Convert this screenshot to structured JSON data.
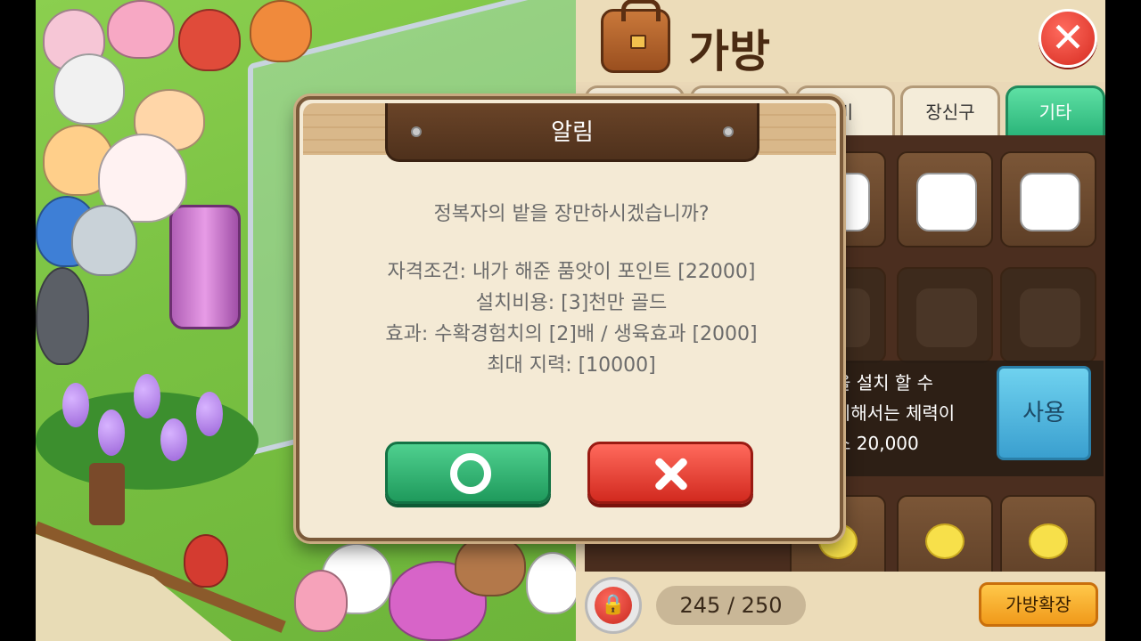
{
  "bag": {
    "title": "가방",
    "tabs": [
      "",
      "",
      "비",
      "장신구",
      "기타"
    ],
    "active_tab": "기타",
    "info_lines": [
      "을 설치 할 수",
      "위해서는 체력이",
      "소 20,000"
    ],
    "use_label": "사용",
    "count": "245 / 250",
    "expand_label": "가방확장",
    "accent_active_tab": "#2bb57a",
    "accent_close": "#d62b20"
  },
  "dialog": {
    "title": "알림",
    "question": "정복자의 밭을 장만하시겠습니까?",
    "lines": [
      "자격조건: 내가 해준 품앗이 포인트 [22000]",
      "설치비용: [3]천만 골드",
      "효과: 수확경험치의 [2]배 / 생육효과 [2000]",
      "최대 지력: [10000]"
    ],
    "confirm_icon": "circle-o-icon",
    "cancel_icon": "x-icon"
  }
}
